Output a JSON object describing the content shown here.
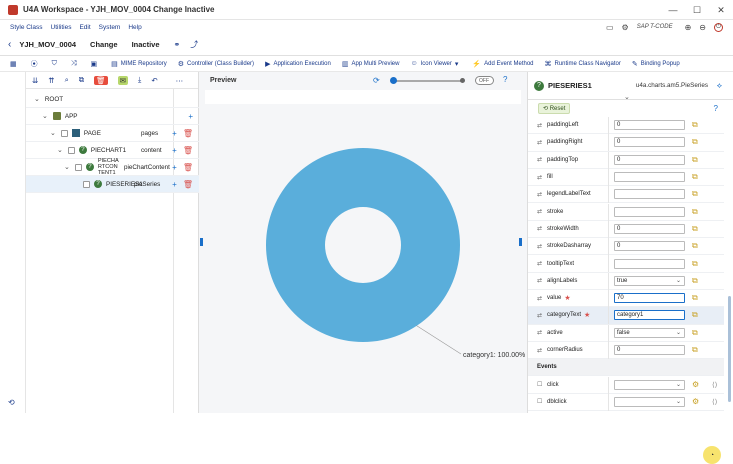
{
  "window": {
    "title": "U4A Workspace - YJH_MOV_0004 Change Inactive"
  },
  "menu": {
    "items": [
      "Style Class",
      "Utilities",
      "Edit",
      "System",
      "Help"
    ],
    "sap_tcode_label": "SAP T-CODE"
  },
  "appbar": {
    "app_name": "YJH_MOV_0004",
    "mode": "Change",
    "status": "Inactive"
  },
  "toolbar": {
    "items": [
      "MIME Repository",
      "Controller (Class Builder)",
      "Application Execution",
      "App Multi Preview",
      "Icon Viewer",
      "Add Event Method",
      "Runtime Class Navigator",
      "Binding Popup"
    ]
  },
  "tree": {
    "rows": [
      {
        "label": "ROOT",
        "agg": "",
        "level": 0
      },
      {
        "label": "APP",
        "agg": "",
        "level": 1
      },
      {
        "label": "PAGE",
        "agg": "pages",
        "level": 2
      },
      {
        "label": "PIECHART1",
        "agg": "content",
        "level": 3
      },
      {
        "label": "PIECHA RTCON TENT1",
        "agg": "pieChartContent",
        "level": 4
      },
      {
        "label": "PIESERIES1",
        "agg": "pieSeries",
        "level": 5
      }
    ]
  },
  "preview": {
    "title": "Preview",
    "toggle_label": "OFF",
    "slider_fraction": 0.03
  },
  "chart_data": {
    "type": "pie",
    "donut": true,
    "categories": [
      "category1"
    ],
    "values": [
      100
    ],
    "data_labels": [
      "category1: 100.00%"
    ],
    "color": "#5aaedb"
  },
  "properties": {
    "name": "PIESERIES1",
    "class_name": "u4a.charts.am5.PieSeries",
    "reset_label": "Reset",
    "rows": [
      {
        "label": "paddingLeft",
        "value": "0",
        "kind": "input"
      },
      {
        "label": "paddingRight",
        "value": "0",
        "kind": "input"
      },
      {
        "label": "paddingTop",
        "value": "0",
        "kind": "input"
      },
      {
        "label": "fill",
        "value": "",
        "kind": "input"
      },
      {
        "label": "legendLabelText",
        "value": "",
        "kind": "input"
      },
      {
        "label": "stroke",
        "value": "",
        "kind": "input"
      },
      {
        "label": "strokeWidth",
        "value": "0",
        "kind": "input"
      },
      {
        "label": "strokeDasharray",
        "value": "0",
        "kind": "input"
      },
      {
        "label": "tooltipText",
        "value": "",
        "kind": "input"
      },
      {
        "label": "alignLabels",
        "value": "true",
        "kind": "select"
      },
      {
        "label": "value",
        "value": "70",
        "kind": "input",
        "required": true
      },
      {
        "label": "categoryText",
        "value": "category1",
        "kind": "input",
        "required": true
      },
      {
        "label": "active",
        "value": "false",
        "kind": "select"
      },
      {
        "label": "cornerRadius",
        "value": "0",
        "kind": "input"
      }
    ],
    "events_label": "Events",
    "events": [
      {
        "label": "click",
        "value": ""
      },
      {
        "label": "dblclick",
        "value": ""
      }
    ]
  }
}
